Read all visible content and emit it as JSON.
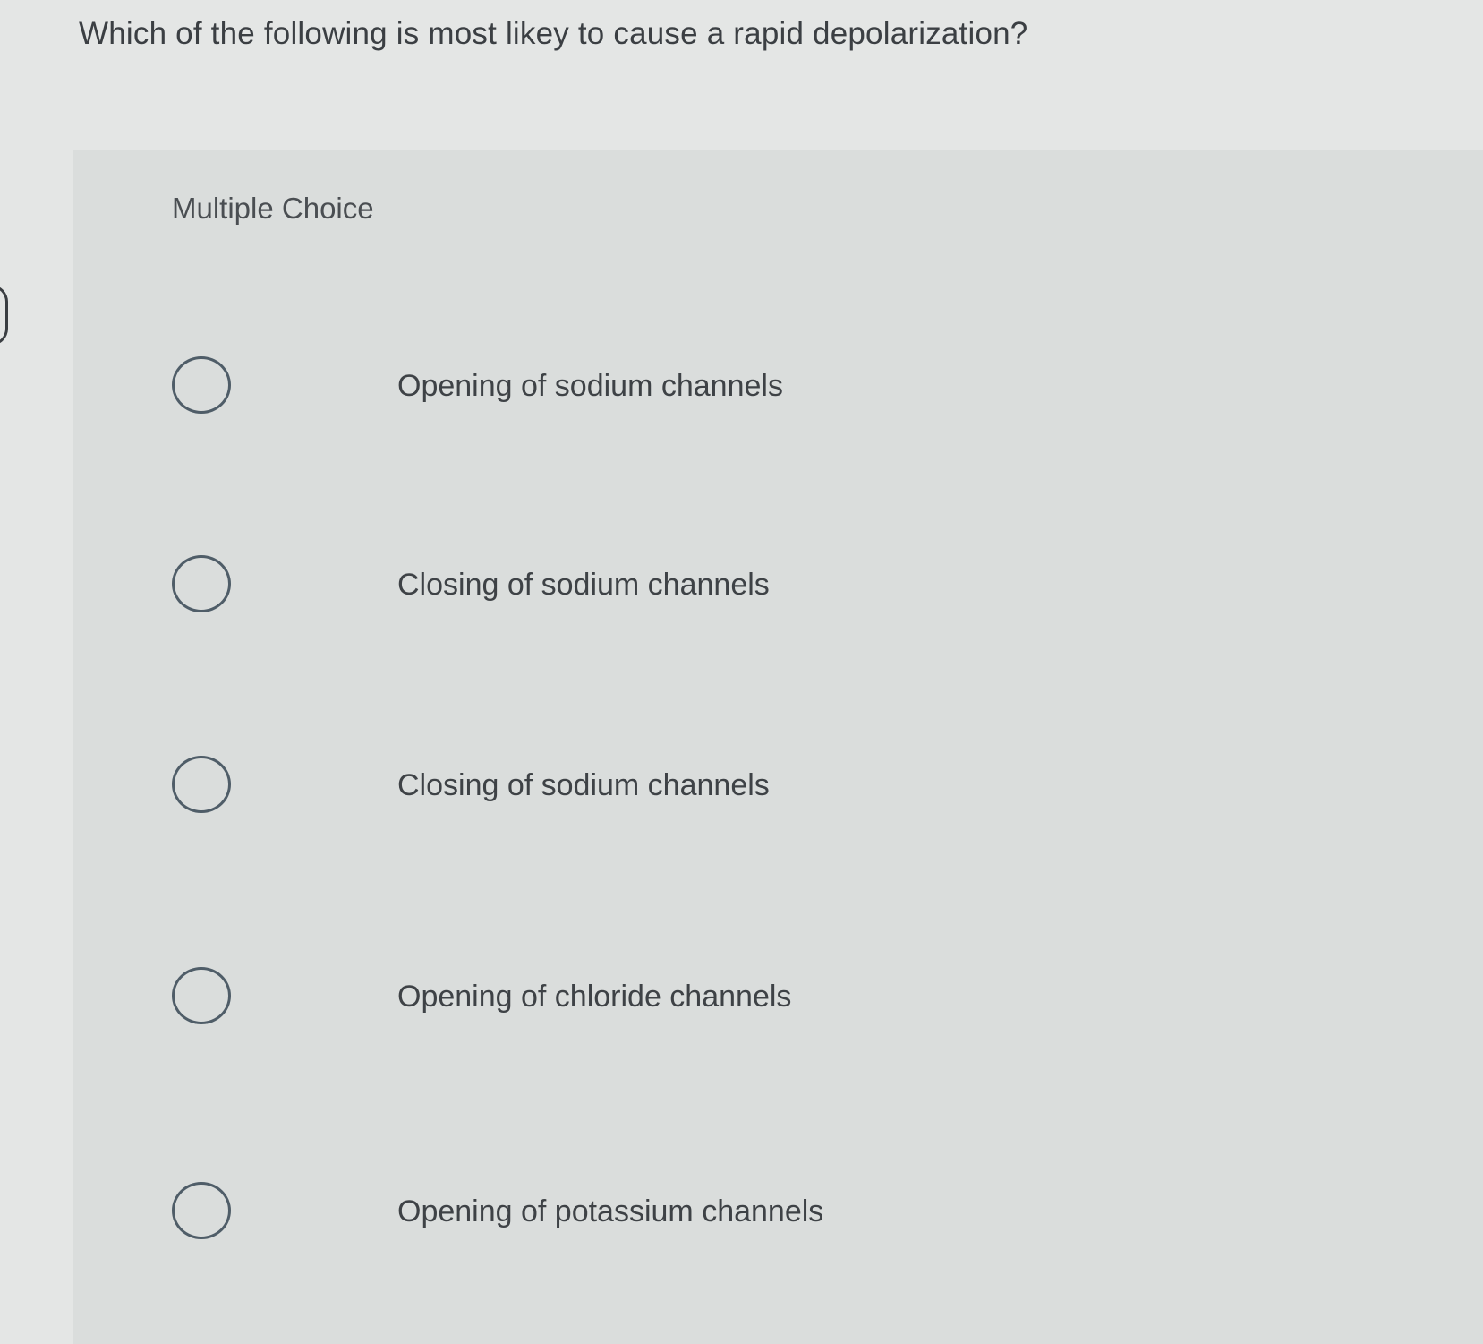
{
  "question": {
    "text": "Which of the following is most likey to cause a rapid depolarization?"
  },
  "panel": {
    "label": "Multiple Choice"
  },
  "choices": [
    {
      "label": "Opening of sodium channels"
    },
    {
      "label": "Closing of sodium channels"
    },
    {
      "label": "Closing of sodium channels"
    },
    {
      "label": "Opening of chloride channels"
    },
    {
      "label": "Opening of potassium channels"
    }
  ],
  "colors": {
    "background": "#e4e6e5",
    "panel": "#dadddc",
    "text": "#3e4246",
    "radio_border": "#4f5d68"
  }
}
